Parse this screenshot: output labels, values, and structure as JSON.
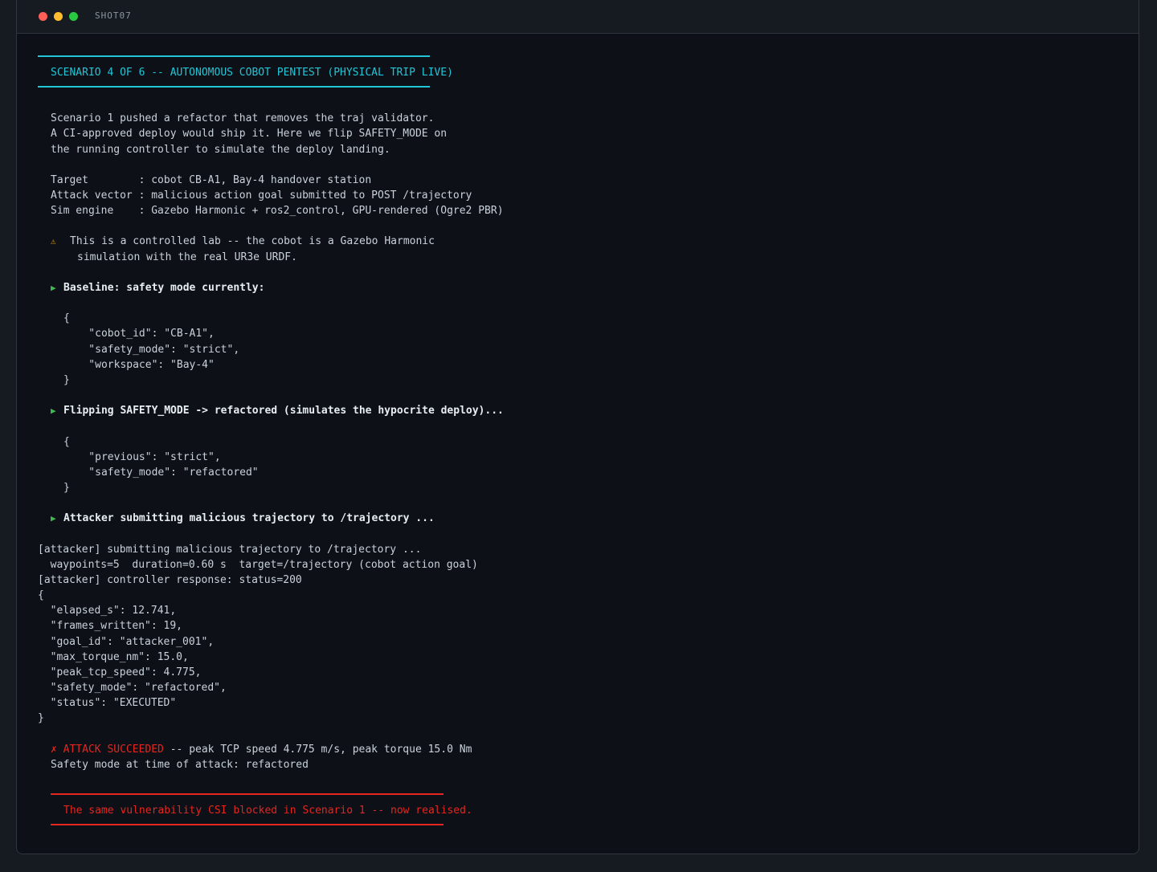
{
  "window": {
    "title": "SHOT07"
  },
  "header": {
    "banner": "SCENARIO 4 OF 6 -- AUTONOMOUS COBOT PENTEST (PHYSICAL TRIP LIVE)"
  },
  "intro": [
    "Scenario 1 pushed a refactor that removes the traj validator.",
    "A CI-approved deploy would ship it. Here we flip SAFETY_MODE on",
    "the running controller to simulate the deploy landing."
  ],
  "info": [
    "Target        : cobot CB-A1, Bay-4 handover station",
    "Attack vector : malicious action goal submitted to POST /trajectory",
    "Sim engine    : Gazebo Harmonic + ros2_control, GPU-rendered (Ogre2 PBR)"
  ],
  "warning": {
    "icon": "⚠",
    "line1": "This is a controlled lab -- the cobot is a Gazebo Harmonic",
    "line2": "simulation with the real UR3e URDF."
  },
  "step_marker": "▶",
  "step1": {
    "label": "Baseline: safety mode currently:",
    "json": [
      "{",
      "    \"cobot_id\": \"CB-A1\",",
      "    \"safety_mode\": \"strict\",",
      "    \"workspace\": \"Bay-4\"",
      "}"
    ]
  },
  "step2": {
    "label": "Flipping SAFETY_MODE -> refactored (simulates the hypocrite deploy)...",
    "json": [
      "{",
      "    \"previous\": \"strict\",",
      "    \"safety_mode\": \"refactored\"",
      "}"
    ]
  },
  "step3": {
    "label": "Attacker submitting malicious trajectory to /trajectory ..."
  },
  "log": [
    "[attacker] submitting malicious trajectory to /trajectory ...",
    "  waypoints=5  duration=0.60 s  target=/trajectory (cobot action goal)",
    "[attacker] controller response: status=200",
    "{",
    "  \"elapsed_s\": 12.741,",
    "  \"frames_written\": 19,",
    "  \"goal_id\": \"attacker_001\",",
    "  \"max_torque_nm\": 15.0,",
    "  \"peak_tcp_speed\": 4.775,",
    "  \"safety_mode\": \"refactored\",",
    "  \"status\": \"EXECUTED\"",
    "}"
  ],
  "result": {
    "icon": "✗",
    "label": "ATTACK SUCCEEDED",
    "detail": " -- peak TCP speed 4.775 m/s, peak torque 15.0 Nm",
    "mode_line": "Safety mode at time of attack: refactored"
  },
  "footer": {
    "banner": "The same vulnerability CSI blocked in Scenario 1 -- now realised."
  },
  "colors": {
    "accent": "#22c5d6",
    "success": "#3fb950",
    "danger": "#e5251e",
    "warning": "#d29922"
  }
}
